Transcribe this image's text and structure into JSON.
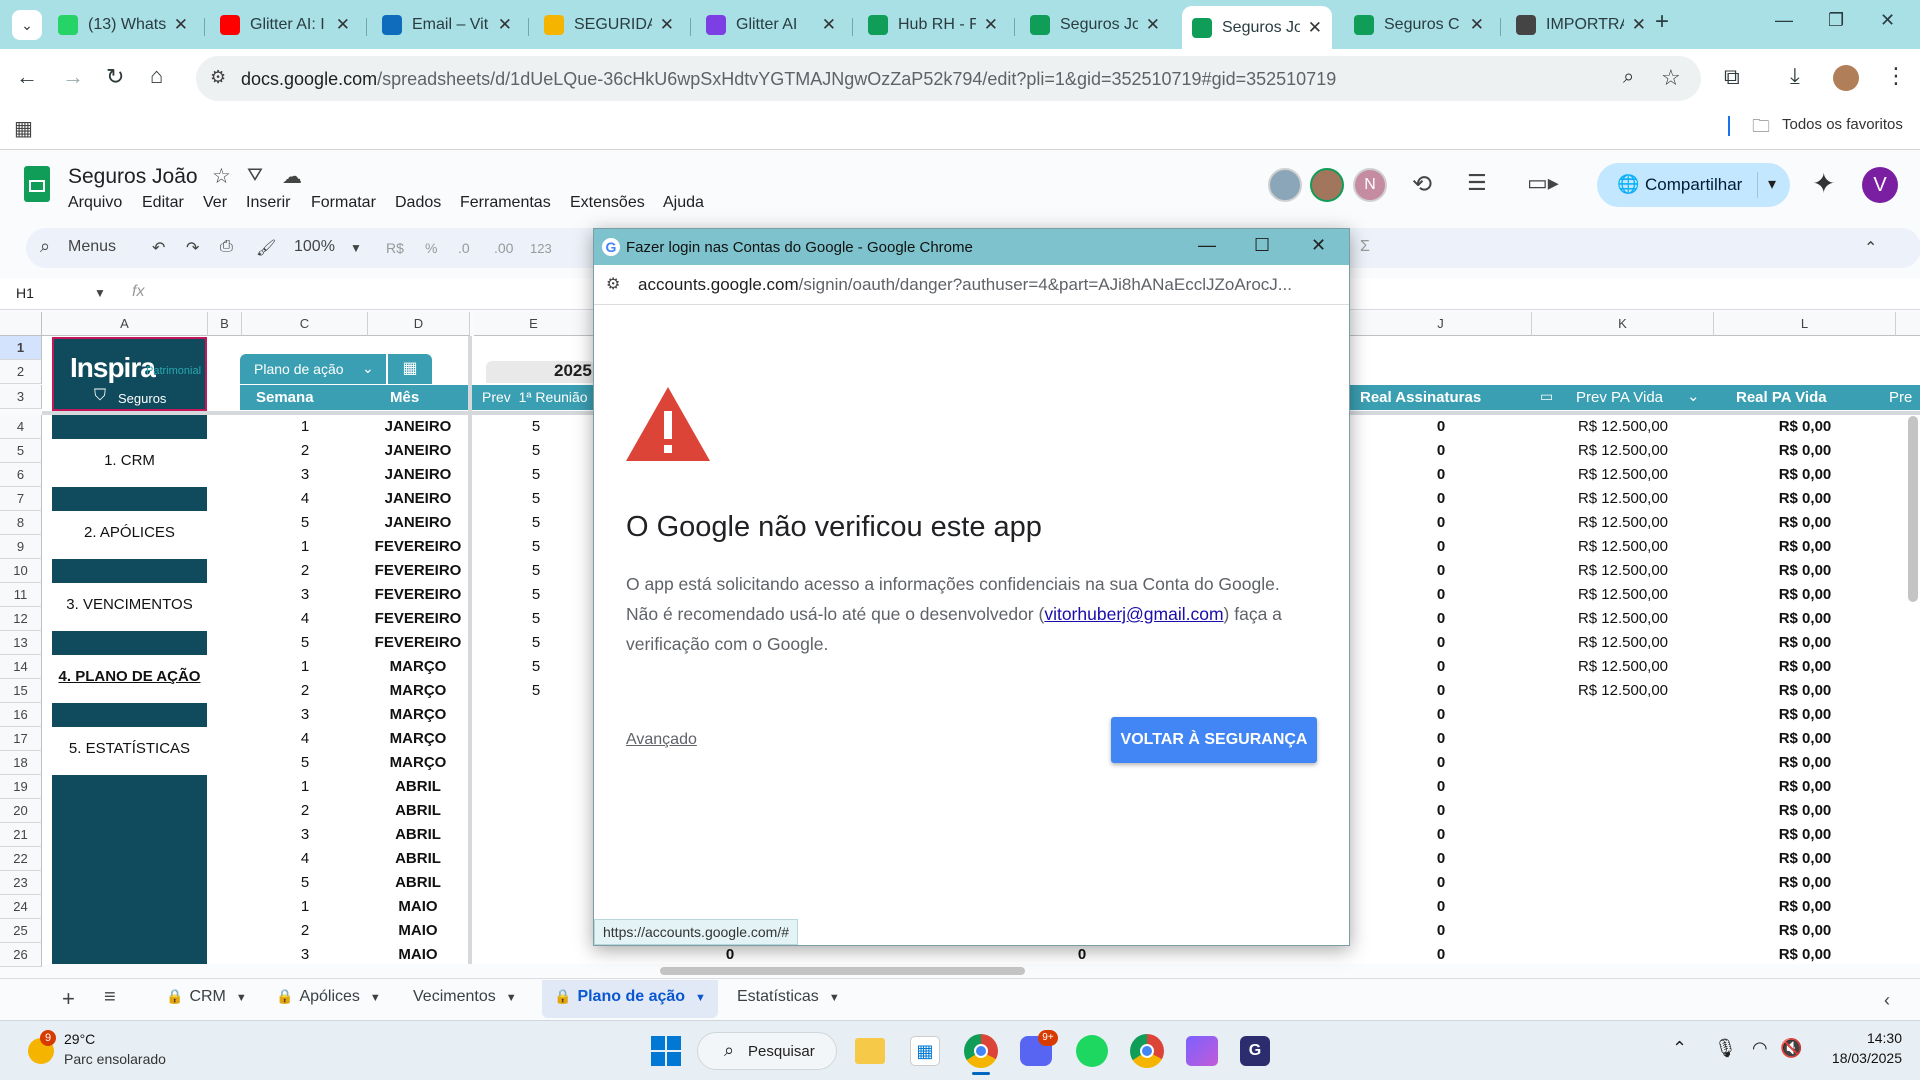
{
  "browser": {
    "tabs": [
      {
        "label": "(13) Whats",
        "icon": "whatsapp-icon",
        "color": "#25d366"
      },
      {
        "label": "Glitter AI: I",
        "icon": "youtube-icon",
        "color": "#ff0000"
      },
      {
        "label": "Email – Vit",
        "icon": "outlook-icon",
        "color": "#0f6cbd"
      },
      {
        "label": "SEGURIDA",
        "icon": "google-drive-icon",
        "color": "#f4b400"
      },
      {
        "label": "Glitter AI",
        "icon": "glitter-icon",
        "color": "#7b3fe4"
      },
      {
        "label": "Hub RH - F",
        "icon": "sheets-icon",
        "color": "#0f9d58"
      },
      {
        "label": "Seguros Jo",
        "icon": "sheets-icon",
        "color": "#0f9d58"
      },
      {
        "label": "Seguros Jo",
        "icon": "sheets-icon",
        "color": "#0f9d58"
      },
      {
        "label": "Seguros C",
        "icon": "sheets-icon",
        "color": "#0f9d58"
      },
      {
        "label": "IMPORTRA",
        "icon": "chatgpt-icon",
        "color": "#444444"
      }
    ],
    "active_tab_index": 7,
    "url_host": "docs.google.com",
    "url_path": "/spreadsheets/d/1dUeLQue-36cHkU6wpSxHdtvYGTMAJNgwOzZaP52k794/edit?pli=1&gid=352510719#gid=352510719",
    "bookmarks_label": "Todos os favoritos"
  },
  "sheets": {
    "doc_title": "Seguros João",
    "menus": [
      "Arquivo",
      "Editar",
      "Ver",
      "Inserir",
      "Formatar",
      "Dados",
      "Ferramentas",
      "Extensões",
      "Ajuda"
    ],
    "share_label": "Compartilhar",
    "avatar_letter": "V",
    "collab_letter": "N",
    "toolbar_menus": "Menus",
    "zoom": "100%",
    "fmt_currency": "R$",
    "fmt_percent": "%",
    "fmt_dec_minus": ".0",
    "fmt_dec_plus": ".00",
    "fmt_123": "123",
    "name_box": "H1",
    "fx": "fx",
    "columns": [
      "A",
      "B",
      "C",
      "D",
      "E",
      "J",
      "K",
      "L"
    ],
    "rows": [
      "1",
      "2",
      "3",
      "4",
      "5",
      "6",
      "7",
      "8",
      "9",
      "10",
      "11",
      "12",
      "13",
      "14",
      "15",
      "16",
      "17",
      "18",
      "19",
      "20",
      "21",
      "22",
      "23",
      "24",
      "25",
      "26"
    ],
    "logo_text": "Inspira",
    "logo_sub": "Patrimonial",
    "logo_seguros": "Seguros",
    "plano_chip": "Plano de ação",
    "year": "2025",
    "headers": {
      "semana": "Semana",
      "mes": "Mês",
      "prev_reuniao": "Prev  1ª Reunião",
      "real_assinaturas": "Real Assinaturas",
      "prev_pa_vida": "Prev PA Vida",
      "real_pa_vida": "Real PA Vida",
      "pre": "Pre"
    },
    "nav": [
      "1. CRM",
      "2. APÓLICES",
      "3. VENCIMENTOS",
      "4. PLANO DE AÇÃO",
      "5. ESTATÍSTICAS"
    ],
    "table": [
      {
        "semana": "1",
        "mes": "JANEIRO",
        "prev": "5",
        "real_ass": "0",
        "prev_pa": "R$ 12.500,00",
        "real_pa": "R$ 0,00"
      },
      {
        "semana": "2",
        "mes": "JANEIRO",
        "prev": "5",
        "real_ass": "0",
        "prev_pa": "R$ 12.500,00",
        "real_pa": "R$ 0,00"
      },
      {
        "semana": "3",
        "mes": "JANEIRO",
        "prev": "5",
        "real_ass": "0",
        "prev_pa": "R$ 12.500,00",
        "real_pa": "R$ 0,00"
      },
      {
        "semana": "4",
        "mes": "JANEIRO",
        "prev": "5",
        "real_ass": "0",
        "prev_pa": "R$ 12.500,00",
        "real_pa": "R$ 0,00"
      },
      {
        "semana": "5",
        "mes": "JANEIRO",
        "prev": "5",
        "real_ass": "0",
        "prev_pa": "R$ 12.500,00",
        "real_pa": "R$ 0,00"
      },
      {
        "semana": "1",
        "mes": "FEVEREIRO",
        "prev": "5",
        "real_ass": "0",
        "prev_pa": "R$ 12.500,00",
        "real_pa": "R$ 0,00"
      },
      {
        "semana": "2",
        "mes": "FEVEREIRO",
        "prev": "5",
        "real_ass": "0",
        "prev_pa": "R$ 12.500,00",
        "real_pa": "R$ 0,00"
      },
      {
        "semana": "3",
        "mes": "FEVEREIRO",
        "prev": "5",
        "real_ass": "0",
        "prev_pa": "R$ 12.500,00",
        "real_pa": "R$ 0,00"
      },
      {
        "semana": "4",
        "mes": "FEVEREIRO",
        "prev": "5",
        "real_ass": "0",
        "prev_pa": "R$ 12.500,00",
        "real_pa": "R$ 0,00"
      },
      {
        "semana": "5",
        "mes": "FEVEREIRO",
        "prev": "5",
        "real_ass": "0",
        "prev_pa": "R$ 12.500,00",
        "real_pa": "R$ 0,00"
      },
      {
        "semana": "1",
        "mes": "MARÇO",
        "prev": "5",
        "real_ass": "0",
        "prev_pa": "R$ 12.500,00",
        "real_pa": "R$ 0,00"
      },
      {
        "semana": "2",
        "mes": "MARÇO",
        "prev": "5",
        "real_ass": "0",
        "prev_pa": "R$ 12.500,00",
        "real_pa": "R$ 0,00"
      },
      {
        "semana": "3",
        "mes": "MARÇO",
        "prev": "",
        "real_ass": "0",
        "prev_pa": "",
        "real_pa": "R$ 0,00"
      },
      {
        "semana": "4",
        "mes": "MARÇO",
        "prev": "",
        "real_ass": "0",
        "prev_pa": "",
        "real_pa": "R$ 0,00"
      },
      {
        "semana": "5",
        "mes": "MARÇO",
        "prev": "",
        "real_ass": "0",
        "prev_pa": "",
        "real_pa": "R$ 0,00"
      },
      {
        "semana": "1",
        "mes": "ABRIL",
        "prev": "",
        "real_ass": "0",
        "prev_pa": "",
        "real_pa": "R$ 0,00"
      },
      {
        "semana": "2",
        "mes": "ABRIL",
        "prev": "",
        "real_ass": "0",
        "prev_pa": "",
        "real_pa": "R$ 0,00"
      },
      {
        "semana": "3",
        "mes": "ABRIL",
        "prev": "",
        "real_ass": "0",
        "prev_pa": "",
        "real_pa": "R$ 0,00"
      },
      {
        "semana": "4",
        "mes": "ABRIL",
        "prev": "",
        "real_ass": "0",
        "prev_pa": "",
        "real_pa": "R$ 0,00"
      },
      {
        "semana": "5",
        "mes": "ABRIL",
        "prev": "",
        "real_ass": "0",
        "prev_pa": "",
        "real_pa": "R$ 0,00"
      },
      {
        "semana": "1",
        "mes": "MAIO",
        "prev": "",
        "real_ass": "0",
        "prev_pa": "",
        "real_pa": "R$ 0,00"
      },
      {
        "semana": "2",
        "mes": "MAIO",
        "prev": "",
        "real_ass": "0",
        "prev_pa": "",
        "real_pa": "R$ 0,00"
      },
      {
        "semana": "3",
        "mes": "MAIO",
        "prev": "",
        "real_ass": "0",
        "prev_pa": "",
        "real_pa": "R$ 0,00"
      }
    ],
    "last_row_extra": [
      "0",
      "0"
    ],
    "sheet_tabs": [
      "CRM",
      "Apólices",
      "Vecimentos",
      "Plano de ação",
      "Estatísticas"
    ],
    "active_sheet_index": 3
  },
  "dialog": {
    "title": "Fazer login nas Contas do Google - Google Chrome",
    "url_host": "accounts.google.com",
    "url_path": "/signin/oauth/danger?authuser=4&part=AJi8hANaEcclJZoArocJ...",
    "heading": "O Google não verificou este app",
    "body_1": "O app está solicitando acesso a informações confidenciais na sua Conta do Google. Não é recomendado usá-lo até que o desenvolvedor (",
    "email": "vitorhuberj@gmail.com",
    "body_2": ") faça a verificação com o Google.",
    "advanced": "Avançado",
    "back_button": "VOLTAR À SEGURANÇA",
    "status_url": "https://accounts.google.com/#",
    "warning_color": "#db4437",
    "button_color": "#4285f4"
  },
  "taskbar": {
    "weather_badge": "9",
    "temp": "29°C",
    "weather_desc": "Parc ensolarado",
    "search_label": "Pesquisar",
    "discord_badge": "9+",
    "time": "14:30",
    "date": "18/03/2025"
  }
}
